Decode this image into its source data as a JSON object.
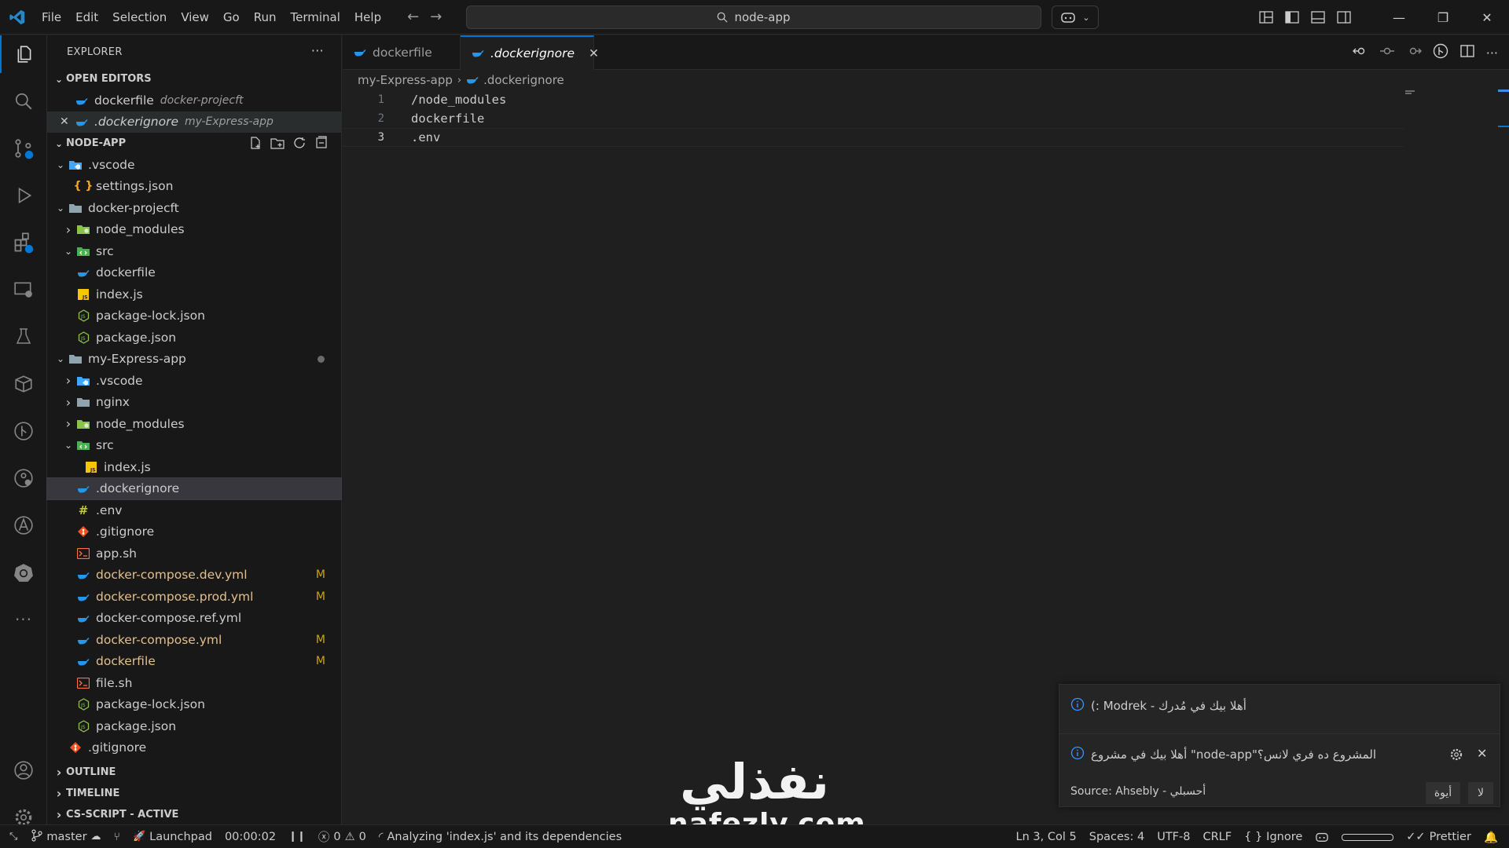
{
  "titlebar": {
    "menu": [
      "File",
      "Edit",
      "Selection",
      "View",
      "Go",
      "Run",
      "Terminal",
      "Help"
    ],
    "search": "node-app"
  },
  "sidebar": {
    "title": "EXPLORER",
    "open_editors": {
      "header": "OPEN EDITORS",
      "items": [
        {
          "name": "dockerfile",
          "desc": "docker-projecft"
        },
        {
          "name": ".dockerignore",
          "desc": "my-Express-app"
        }
      ]
    },
    "workspace": {
      "header": "NODE-APP",
      "tree": [
        {
          "label": ".vscode",
          "icon": "vscode-folder-icon",
          "depth": 0,
          "state": "open"
        },
        {
          "label": "settings.json",
          "icon": "json-braces-icon",
          "depth": 1
        },
        {
          "label": "docker-projecft",
          "icon": "folder-icon",
          "depth": 0,
          "state": "open"
        },
        {
          "label": "node_modules",
          "icon": "node-folder-icon",
          "depth": 1,
          "state": "closed"
        },
        {
          "label": "src",
          "icon": "src-folder-icon",
          "depth": 1,
          "state": "open"
        },
        {
          "label": "dockerfile",
          "icon": "docker-icon",
          "depth": 1
        },
        {
          "label": "index.js",
          "icon": "js-icon",
          "depth": 1
        },
        {
          "label": "package-lock.json",
          "icon": "node-json-icon",
          "depth": 1
        },
        {
          "label": "package.json",
          "icon": "node-json-icon",
          "depth": 1
        },
        {
          "label": "my-Express-app",
          "icon": "folder-icon",
          "depth": 0,
          "state": "open",
          "dot": true
        },
        {
          "label": ".vscode",
          "icon": "vscode-folder-icon",
          "depth": 1,
          "state": "closed"
        },
        {
          "label": "nginx",
          "icon": "folder-icon",
          "depth": 1,
          "state": "closed"
        },
        {
          "label": "node_modules",
          "icon": "node-folder-icon",
          "depth": 1,
          "state": "closed"
        },
        {
          "label": "src",
          "icon": "src-folder-icon",
          "depth": 1,
          "state": "open"
        },
        {
          "label": "index.js",
          "icon": "js-icon",
          "depth": 2
        },
        {
          "label": ".dockerignore",
          "icon": "docker-icon",
          "depth": 1,
          "selected": true
        },
        {
          "label": ".env",
          "icon": "env-icon",
          "depth": 1
        },
        {
          "label": ".gitignore",
          "icon": "git-icon",
          "depth": 1
        },
        {
          "label": "app.sh",
          "icon": "shell-icon",
          "depth": 1
        },
        {
          "label": "docker-compose.dev.yml",
          "icon": "docker-icon",
          "depth": 1,
          "badge": "M"
        },
        {
          "label": "docker-compose.prod.yml",
          "icon": "docker-icon",
          "depth": 1,
          "badge": "M"
        },
        {
          "label": "docker-compose.ref.yml",
          "icon": "docker-icon",
          "depth": 1
        },
        {
          "label": "docker-compose.yml",
          "icon": "docker-icon",
          "depth": 1,
          "badge": "M"
        },
        {
          "label": "dockerfile",
          "icon": "docker-icon",
          "depth": 1,
          "badge": "M"
        },
        {
          "label": "file.sh",
          "icon": "shell-icon",
          "depth": 1
        },
        {
          "label": "package-lock.json",
          "icon": "node-json-icon",
          "depth": 1
        },
        {
          "label": "package.json",
          "icon": "node-json-icon",
          "depth": 1
        },
        {
          "label": ".gitignore",
          "icon": "git-icon",
          "depth": 0
        }
      ]
    },
    "sections": [
      "OUTLINE",
      "TIMELINE",
      "CS-SCRIPT - ACTIVE"
    ]
  },
  "tabs": [
    {
      "label": "dockerfile",
      "active": false
    },
    {
      "label": ".dockerignore",
      "active": true
    }
  ],
  "editor": {
    "breadcrumb": [
      "my-Express-app",
      ".dockerignore"
    ],
    "lines": [
      {
        "num": "1",
        "text": "/node_modules"
      },
      {
        "num": "2",
        "text": "dockerfile"
      },
      {
        "num": "3",
        "text": ".env"
      }
    ]
  },
  "notifications": {
    "first": "أهلا بيك في مُدرك - Modrek :)",
    "second": "المشروع ده فري لانس؟\"node-app\" أهلا بيك في مشروع",
    "source": "Source: Ahsebly - أحسبلي",
    "yes": "أيوة",
    "no": "لا"
  },
  "statusbar": {
    "branch": "master",
    "launchpad": "Launchpad",
    "timer": "00:00:02",
    "errors": "0",
    "warnings": "0",
    "analyzing": "Analyzing 'index.js' and its dependencies",
    "position": "Ln 3, Col 5",
    "spaces": "Spaces: 4",
    "encoding": "UTF-8",
    "eol": "CRLF",
    "language": "Ignore",
    "prettier": "Prettier"
  },
  "watermark": {
    "arabic": "نفذلي",
    "latin": "nafezly.com"
  },
  "colors": {
    "accent": "#0078d4",
    "docker": "#2496ed",
    "modified": "#e2c08d",
    "badge": "#cca700"
  }
}
